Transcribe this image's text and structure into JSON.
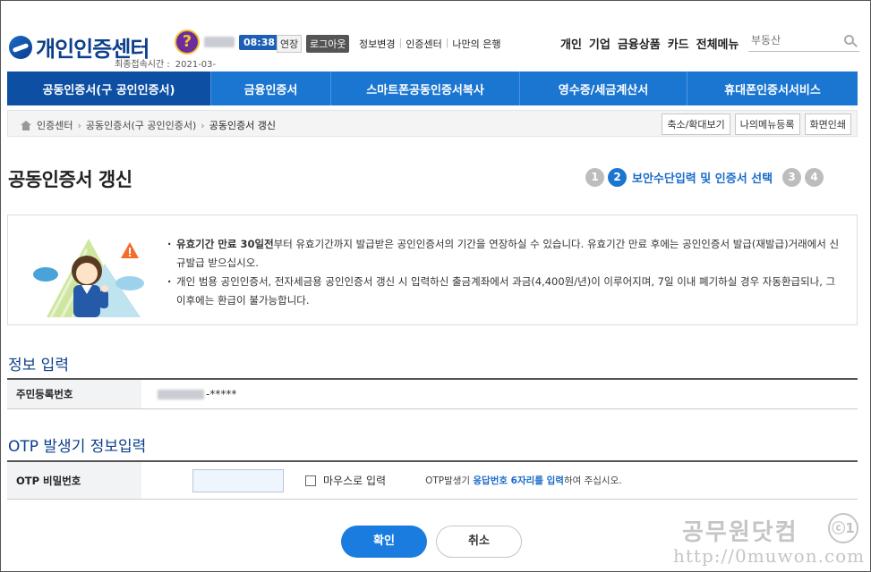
{
  "header": {
    "logo_text": "개인인증센터",
    "timer": "08:38",
    "extend_label": "연장",
    "logout_label": "로그아웃",
    "util_links": [
      "정보변경",
      "인증센터",
      "나만의 은행"
    ],
    "last_login_label": "최종접속시간 :",
    "last_login_value": "2021-03-",
    "top_menu": [
      "개인",
      "기업",
      "금융상품",
      "카드",
      "전체메뉴"
    ],
    "search_placeholder": "부동산"
  },
  "gnb": {
    "items": [
      "공동인증서(구 공인인증서)",
      "금융인증서",
      "스마트폰공동인증서복사",
      "영수증/세금계산서",
      "휴대폰인증서서비스"
    ]
  },
  "breadcrumb": {
    "items": [
      "인증센터",
      "공동인증서(구 공인인증서)",
      "공동인증서 갱신"
    ],
    "buttons": [
      "축소/확대보기",
      "나의메뉴등록",
      "화면인쇄"
    ]
  },
  "page": {
    "title": "공동인증서 갱신",
    "steps": [
      "1",
      "2",
      "3",
      "4"
    ],
    "current_step_label": "보안수단입력 및 인증서 선택"
  },
  "notice": {
    "line1_bold": "유효기간 만료 30일전",
    "line1_rest": "부터 유효기간까지 발급받은 공인인증서의 기간을 연장하실 수 있습니다. 유효기간 만료 후에는 공인인증서 발급(재발급)거래에서 신규발급 받으십시오.",
    "line2": "개인 범용 공인인증서, 전자세금용 공인인증서 갱신 시 입력하신 출금계좌에서 과금(4,400원/년)이 이루어지며, 7일 이내 폐기하실 경우 자동환급되나, 그 이후에는 환급이 불가능합니다."
  },
  "info_section": {
    "title": "정보 입력",
    "ssn_label": "주민등록번호",
    "ssn_suffix": "-*****"
  },
  "otp_section": {
    "title": "OTP 발생기 정보입력",
    "pw_label": "OTP 비밀번호",
    "mouse_input_label": "마우스로 입력",
    "help_prefix": "OTP발생기 ",
    "help_emph": "응답번호 6자리를 입력",
    "help_suffix": "하여 주십시오."
  },
  "buttons": {
    "ok": "확인",
    "cancel": "취소"
  },
  "watermark": {
    "text": "공무원닷컴",
    "logo": "ⓒ1",
    "url": "http://0muwon.com"
  },
  "colors": {
    "brand_blue": "#1b76d1",
    "nav_active": "#0c4fa3",
    "title_navy": "#0c3f8c"
  }
}
